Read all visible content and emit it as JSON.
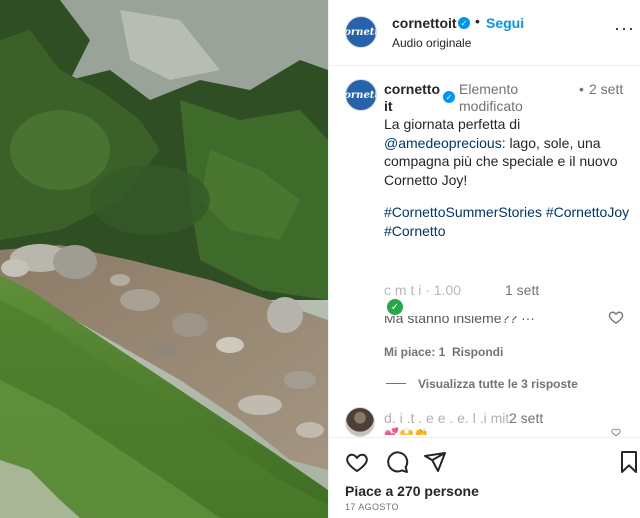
{
  "post": {
    "media_alt": "Mountain stream with rocks and green vegetation"
  },
  "header": {
    "avatar_text": "Cornetto",
    "username": "cornettoit",
    "verified_icon": "verified-badge-icon",
    "separator": "•",
    "follow_label": "Segui",
    "subtitle": "Audio originale",
    "more_icon": "more-options-icon",
    "more_label": "···"
  },
  "caption": {
    "avatar_text": "Cornetto",
    "username": "cornetto it",
    "edited_label": "Elemento modificato",
    "bullet": "•",
    "time": "2 sett",
    "text_before": "La giornata perfetta di ",
    "mention": "@amedeoprecious",
    "text_after": ": lago, sole, una compagna più che speciale e il nuovo Cornetto Joy!",
    "hashtags": "#CornettoSummerStories #CornettoJoy #Cornetto"
  },
  "comment1": {
    "header_faded": "c m  t  i    ·  1.00",
    "time": "1 sett",
    "check_icon": "check-badge-icon",
    "text_faded": "Ma stanno insieme?? ···",
    "likes": "Mi piace: 1",
    "reply": "Rispondi"
  },
  "replies": {
    "label": "Visualizza tutte le 3 risposte"
  },
  "comment2": {
    "username_faded": "d. i .t . e e .  e. l .i mit",
    "time": "2 sett",
    "emoji": "💕🙌👏"
  },
  "actions": {
    "like_icon": "heart-icon",
    "comment_icon": "comment-icon",
    "share_icon": "share-icon",
    "save_icon": "bookmark-icon",
    "likes_text": "Piace a 270 persone",
    "date": "17 AGOSTO"
  },
  "colors": {
    "link_blue": "#0095f6",
    "mention_blue": "#00376b",
    "muted": "#737373",
    "text": "#262626"
  }
}
